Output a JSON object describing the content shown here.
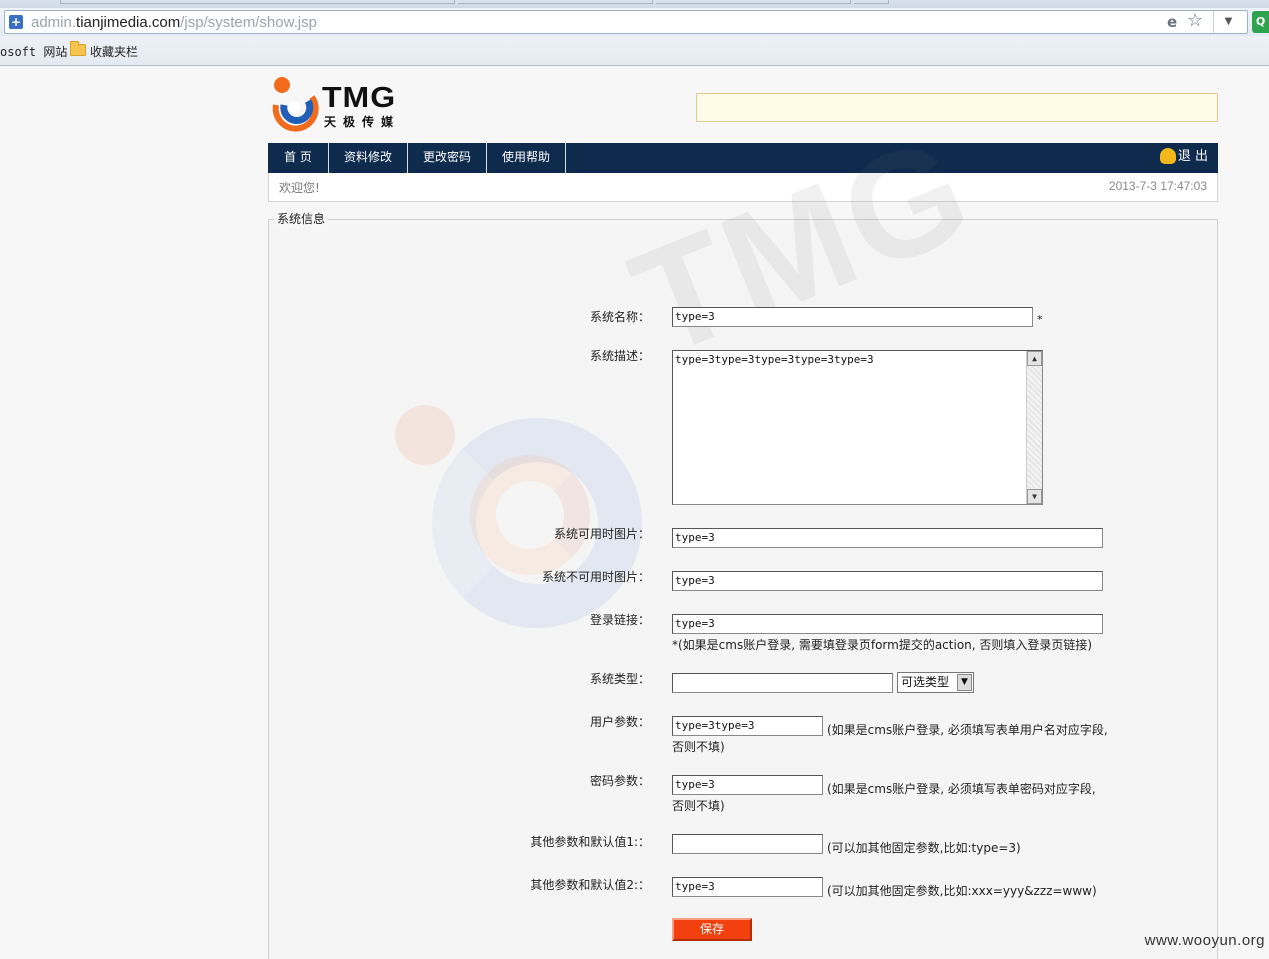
{
  "browser": {
    "url_prefix": "admin.",
    "url_host": "tianjimedia.com",
    "url_path": "/jsp/system/show.jsp",
    "bookmarks": [
      "osoft 网站",
      "收藏夹栏"
    ],
    "icons": [
      "page-icon",
      "compatibility-icon",
      "star-icon",
      "dropdown-icon",
      "folder-icon"
    ]
  },
  "header": {
    "logo_text": "TMG",
    "logo_cn": "天极传媒",
    "search_value": ""
  },
  "nav": {
    "items": [
      "首 页",
      "资料修改",
      "更改密码",
      "使用帮助"
    ],
    "logout": "退 出",
    "color": "#0e2a4d"
  },
  "welcome": {
    "greeting": "欢迎您!",
    "datetime": "2013-7-3 17:47:03"
  },
  "form": {
    "legend": "系统信息",
    "fields": {
      "name": {
        "label": "系统名称：",
        "value": "type=3",
        "required": "*"
      },
      "desc": {
        "label": "系统描述：",
        "value": "type=3type=3type=3type=3type=3"
      },
      "img_available": {
        "label": "系统可用时图片：",
        "value": "type=3"
      },
      "img_unavailable": {
        "label": "系统不可用时图片：",
        "value": "type=3"
      },
      "login_link": {
        "label": "登录链接：",
        "value": "type=3",
        "note": "*(如果是cms账户登录, 需要填登录页form提交的action, 否则填入登录页链接)"
      },
      "sys_type": {
        "label": "系统类型：",
        "value": "",
        "select": "可选类型"
      },
      "user_param": {
        "label": "用户参数：",
        "value": "type=3type=3",
        "note1": "(如果是cms账户登录, 必须填写表单用户名对应字段,",
        "note2": "否则不填)"
      },
      "pwd_param": {
        "label": "密码参数：",
        "value": "type=3",
        "note1": "(如果是cms账户登录, 必须填写表单密码对应字段,",
        "note2": "否则不填)"
      },
      "other1": {
        "label": "其他参数和默认值1:：",
        "value": "",
        "note": "(可以加其他固定参数,比如:type=3)"
      },
      "other2": {
        "label": "其他参数和默认值2:：",
        "value": "type=3",
        "note": "(可以加其他固定参数,比如:xxx=yyy&zzz=www)"
      }
    },
    "save": "保存",
    "save_color": "#f2410e"
  },
  "watermark_site": "www.wooyun.org"
}
